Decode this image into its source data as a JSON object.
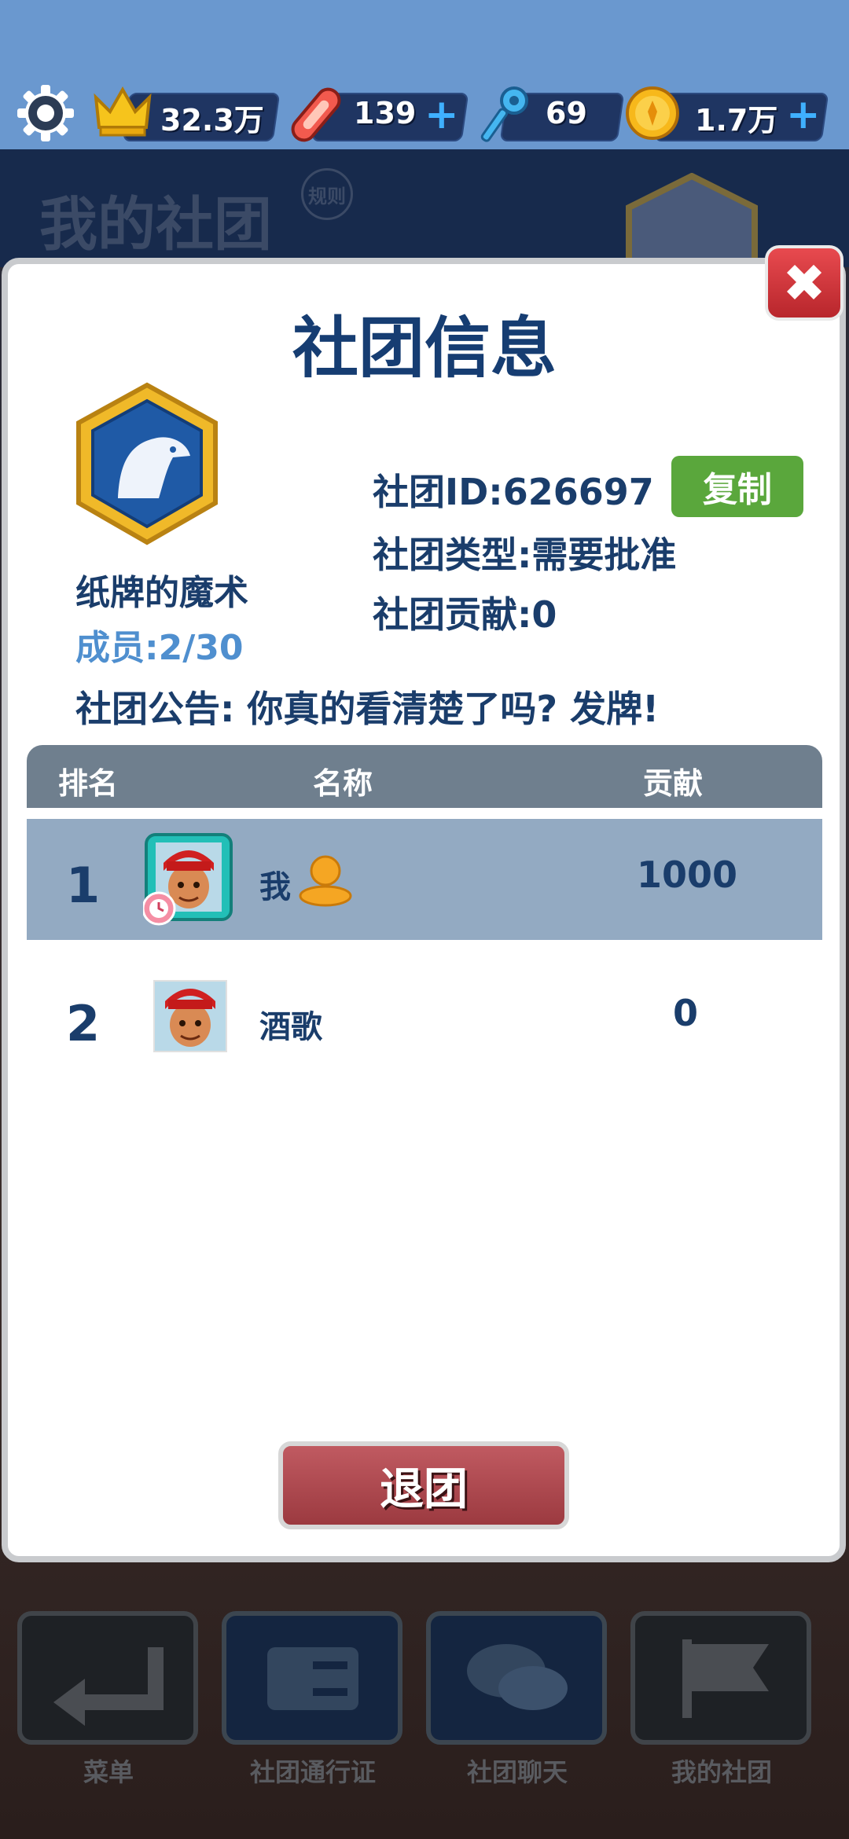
{
  "topbar": {
    "crowns": "32.3万",
    "boards": "139",
    "keys": "69",
    "coins": "1.7万",
    "plus": "+"
  },
  "background": {
    "title": "我的社团",
    "rules": "规则"
  },
  "dialog": {
    "title": "社团信息",
    "club_name": "纸牌的魔术",
    "members": "成员:2/30",
    "club_id": "社团ID:626697",
    "copy_button": "复制",
    "club_type": "社团类型:需要批准",
    "contribution": "社团贡献:0",
    "notice": "社团公告: 你真的看清楚了吗? 发牌!",
    "close": "✖",
    "leave_button": "退团"
  },
  "table": {
    "headers": [
      "排名",
      "名称",
      "贡献"
    ],
    "rows": [
      {
        "rank": "1",
        "name": "我",
        "contribution": "1000"
      },
      {
        "rank": "2",
        "name": "酒歌",
        "contribution": "0"
      }
    ]
  },
  "nav": {
    "items": [
      "菜单",
      "社团通行证",
      "社团聊天",
      "我的社团"
    ]
  },
  "colors": {
    "accent": "#163d72",
    "copy": "#5aa73c",
    "leave": "#b04b52",
    "close": "#d8343a"
  }
}
